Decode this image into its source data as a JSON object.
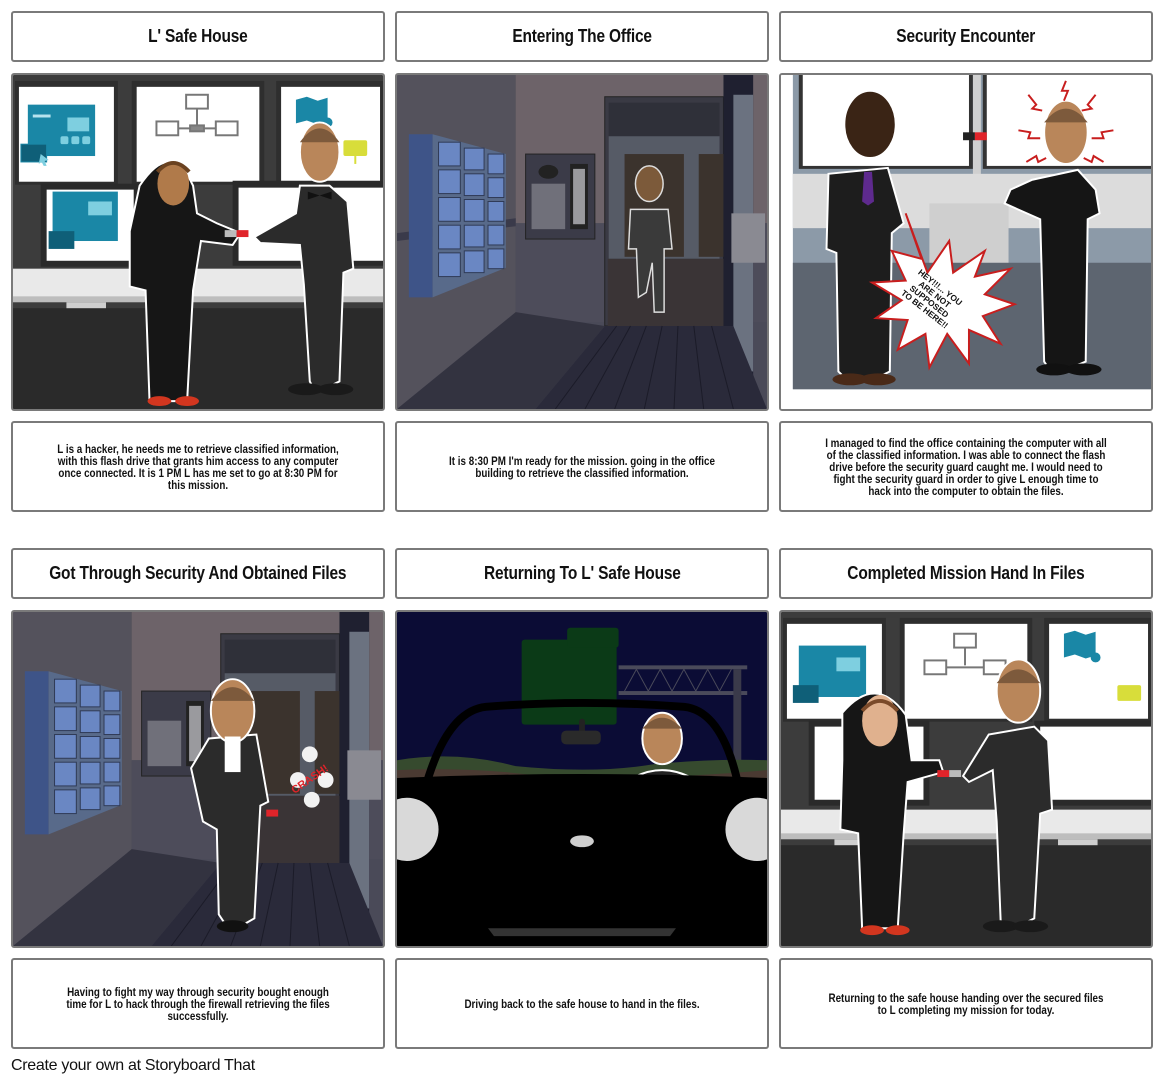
{
  "storyboard": {
    "panels": [
      {
        "title": "L' Safe House",
        "caption": "L is a hacker, he needs me to retrieve classified information, with this flash drive that grants him access to any computer once connected. It is 1 PM L has me set to go at 8:30 PM for this mission.",
        "scene": "hacker-in-hoodie handing flash drive to agent in tuxedo in front of computer monitors"
      },
      {
        "title": "Entering The Office",
        "caption": "It is 8:30 PM I'm ready for the mission. going in the office building to retrieve the classified information.",
        "scene": "agent walking into office lobby past mailboxes and intercom"
      },
      {
        "title": "Security Encounter",
        "caption": "I managed to find the office containing the computer with all of the classified information. I was able to connect the flash drive before the security guard caught me. I would need to fight the security guard in order to give L enough time to hack into the computer to obtain the files.",
        "scene": "security guard confronting startled agent in computer room",
        "speech_bubble": "HEY!!!... YOU ARE NOT SUPPOSED TO BE HERE!!"
      },
      {
        "title": "Got Through Security And Obtained Files",
        "caption": "Having to fight my way through security bought enough time for L to hack through the firewall retrieving the files successfully.",
        "scene": "agent walking out of lobby holding flash drive",
        "sound_effect": "CRASH!"
      },
      {
        "title": "Returning To L' Safe House",
        "caption": "Driving back to the safe house to hand in the files.",
        "scene": "agent driving black convertible at night under highway sign"
      },
      {
        "title": "Completed Mission Hand In Files",
        "caption": "Returning to the safe house handing over the secured files to L completing my mission for today.",
        "scene": "agent handing flash drive back to smiling hacker in front of monitors"
      }
    ]
  },
  "footer": {
    "text": "Create your own at Storyboard That"
  },
  "colors": {
    "border": "#7a7a7a",
    "flash_drive_red": "#e0242a",
    "speech_bubble_outline": "#c81e1e",
    "monitor_icon_teal": "#1a87a6",
    "folder_icon_yellow": "#d8dd3a",
    "night_sky": "#0b0c35",
    "highway_sign_green": "#0b3a17"
  }
}
